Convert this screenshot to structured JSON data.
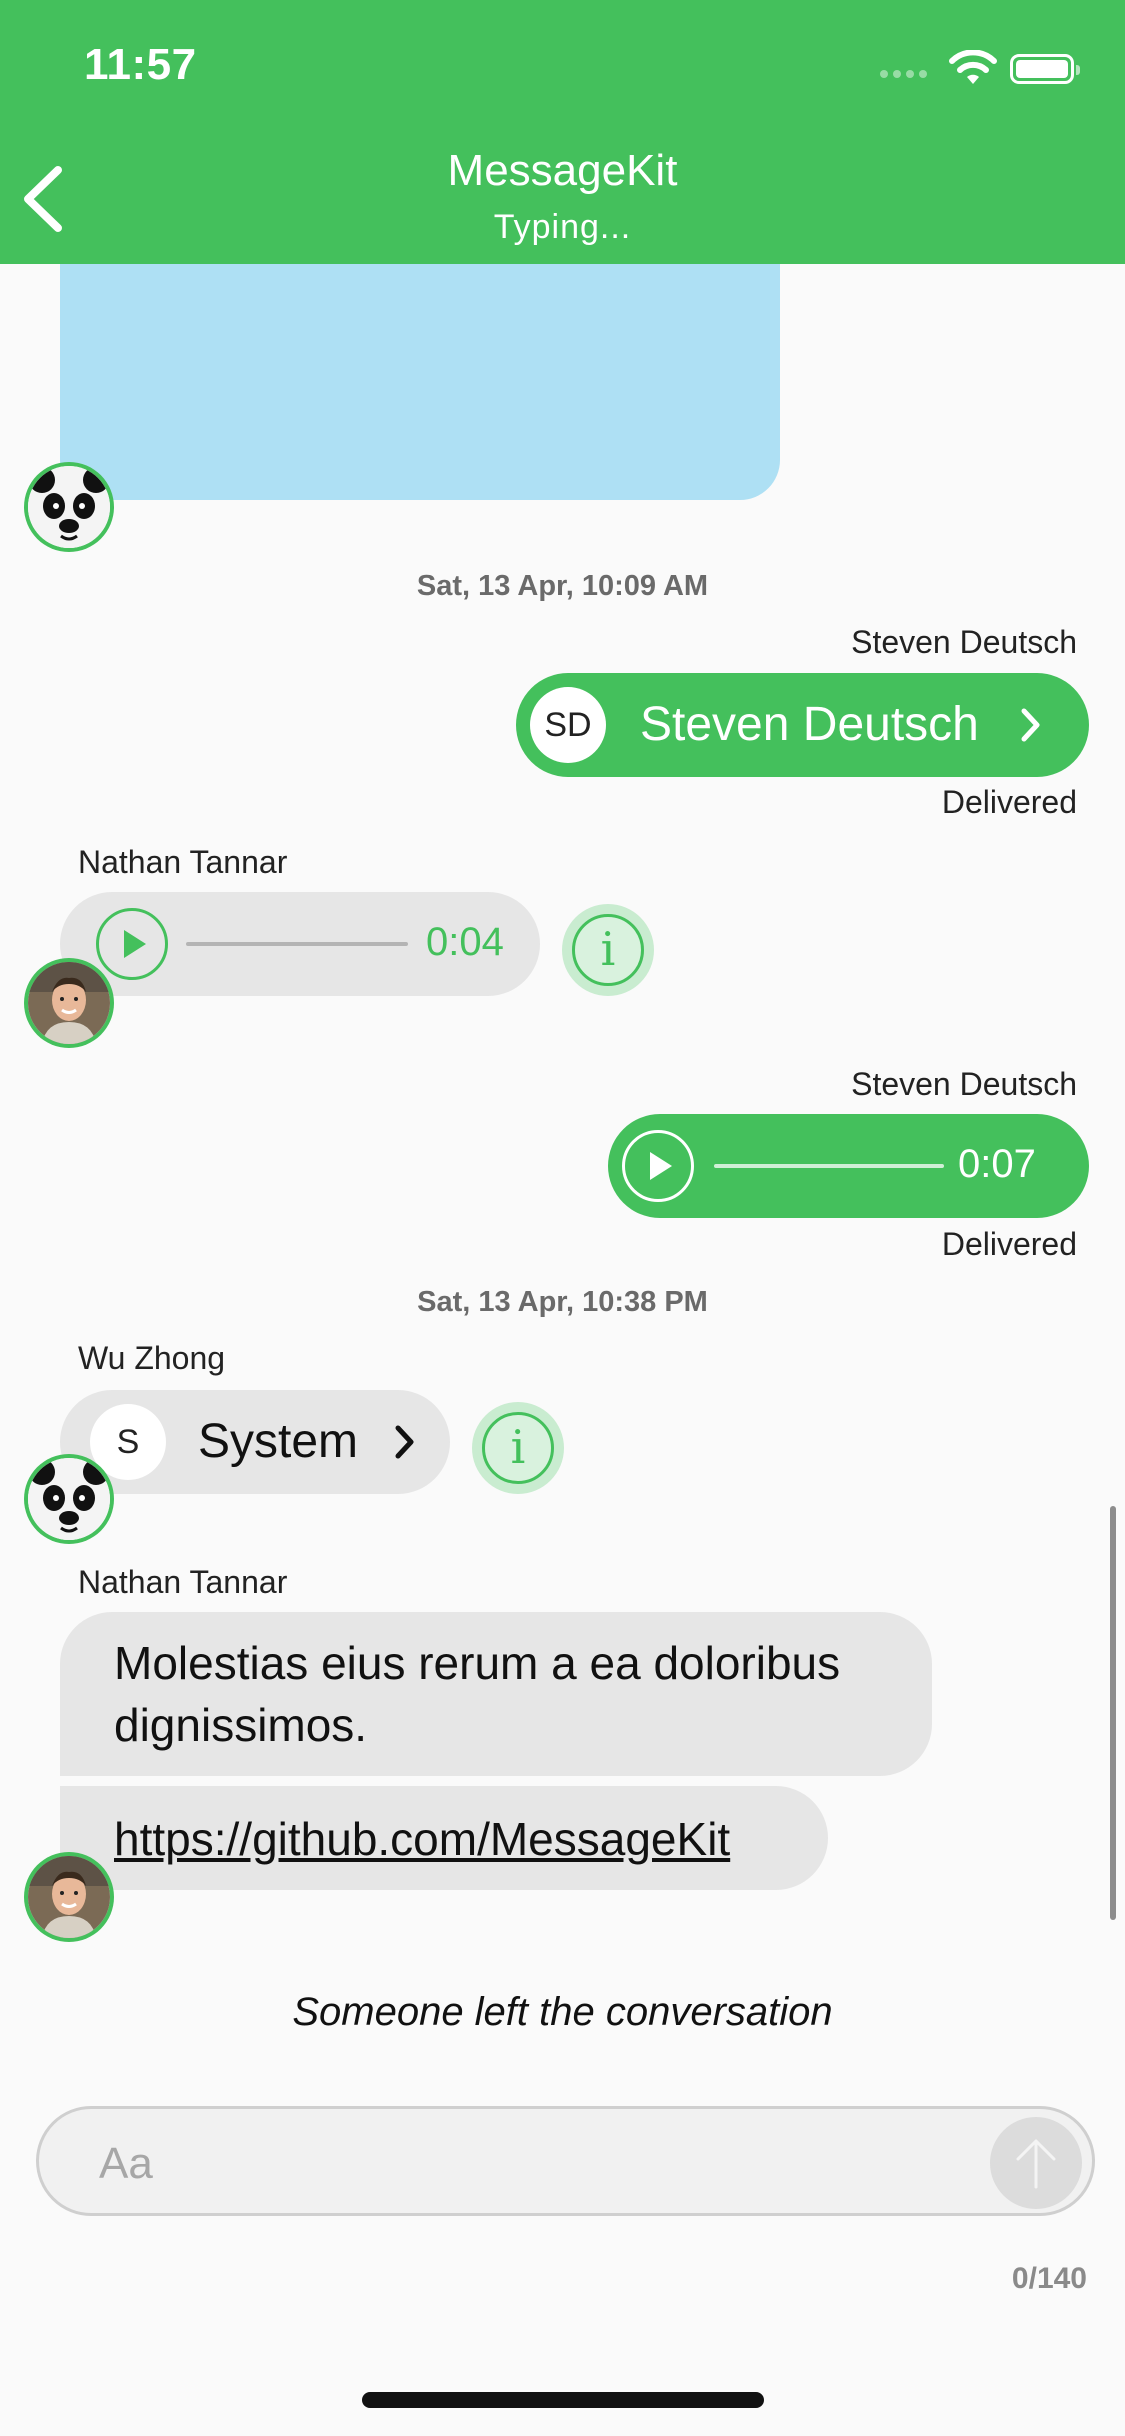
{
  "status_bar": {
    "time": "11:57"
  },
  "nav": {
    "title": "MessageKit",
    "subtitle": "Typing..."
  },
  "messages": {
    "timestamp1": "Sat, 13 Apr, 10:09 AM",
    "contact_msg": {
      "sender": "Steven Deutsch",
      "initials": "SD",
      "name": "Steven Deutsch",
      "status": "Delivered"
    },
    "audio_msg1": {
      "sender": "Nathan Tannar",
      "duration": "0:04"
    },
    "audio_msg2": {
      "sender": "Steven Deutsch",
      "duration": "0:07",
      "status": "Delivered"
    },
    "timestamp2": "Sat, 13 Apr, 10:38 PM",
    "contact_msg2": {
      "sender": "Wu Zhong",
      "initials": "S",
      "name": "System"
    },
    "text_msg": {
      "sender": "Nathan Tannar",
      "line1": "Molestias eius rerum a ea doloribus",
      "line2": "dignissimos.",
      "link": "https://github.com/MessageKit"
    },
    "system_msg": "Someone left the conversation"
  },
  "input": {
    "placeholder": "Aa",
    "counter": "0/140"
  },
  "colors": {
    "accent": "#44c05c",
    "photo_bubble": "#aee0f4",
    "incoming_bubble": "#e6e6e6"
  },
  "icons": [
    "back-chevron-icon",
    "wifi-icon",
    "battery-icon",
    "play-icon",
    "info-icon",
    "chevron-right-icon",
    "send-arrow-icon"
  ]
}
